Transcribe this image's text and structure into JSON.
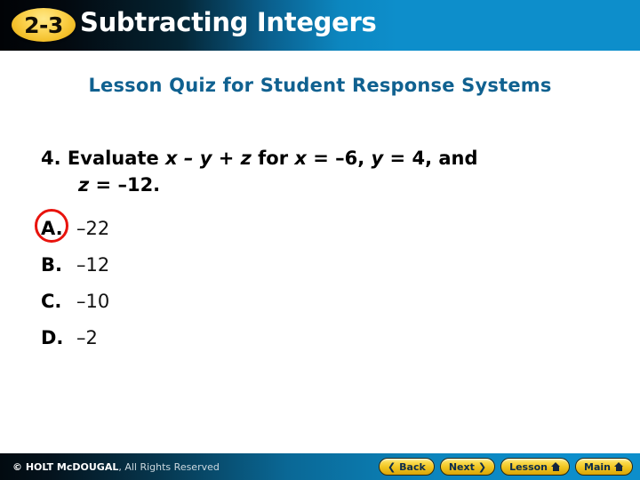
{
  "header": {
    "badge": "2-3",
    "title": "Subtracting Integers"
  },
  "subtitle": "Lesson Quiz for Student Response Systems",
  "question": {
    "number": "4.",
    "line1_prefix": "Evaluate ",
    "expression": "x – y + z",
    "line1_mid": " for ",
    "x_var": "x",
    "x_assign": " = –6, ",
    "y_var": "y",
    "y_assign": " = 4, and",
    "z_var": "z",
    "z_assign": " = –12."
  },
  "choices": [
    {
      "letter": "A.",
      "value": "–22",
      "selected": true
    },
    {
      "letter": "B.",
      "value": "–12",
      "selected": false
    },
    {
      "letter": "C.",
      "value": "–10",
      "selected": false
    },
    {
      "letter": "D.",
      "value": "–2",
      "selected": false
    }
  ],
  "footer": {
    "copyright_bold": "© HOLT McDOUGAL",
    "copyright_rest": ", All Rights Reserved",
    "buttons": [
      {
        "label": "Back",
        "icon": "chevron-left-icon",
        "glyph": "❮"
      },
      {
        "label": "Next",
        "icon": "chevron-right-icon",
        "glyph": "❯"
      },
      {
        "label": "Lesson",
        "icon": "home-icon",
        "glyph": ""
      },
      {
        "label": "Main",
        "icon": "home-icon",
        "glyph": ""
      }
    ]
  },
  "colors": {
    "header_accent": "#0d8ecb",
    "badge_yellow": "#f3c02b",
    "subtitle_teal": "#106190",
    "marker_red": "#e8130d",
    "button_yellow": "#fada4e"
  }
}
